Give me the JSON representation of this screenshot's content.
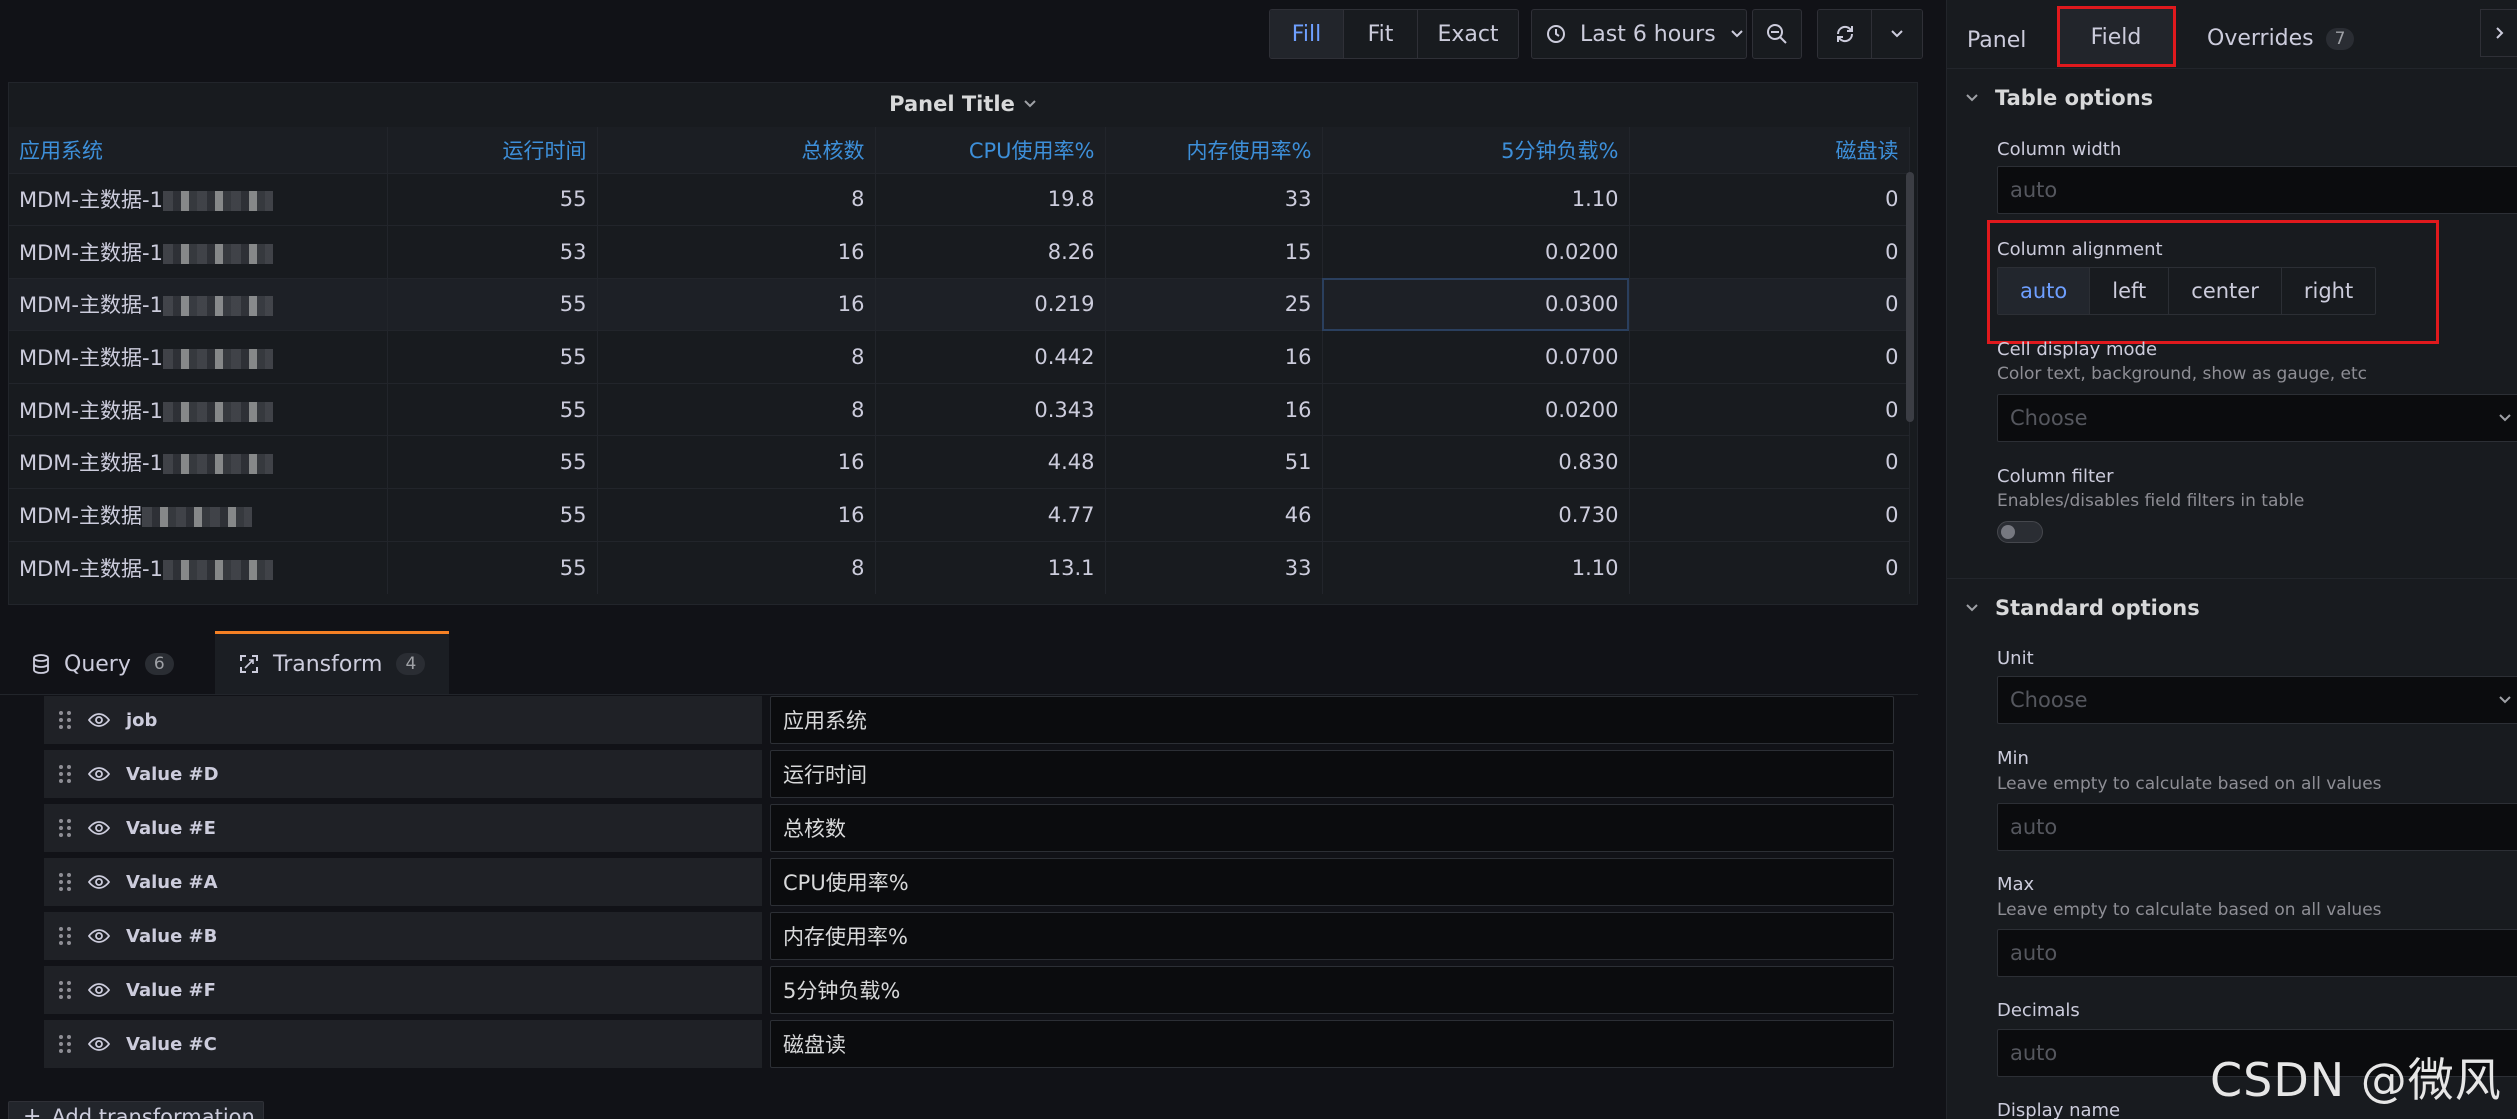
{
  "toolbar": {
    "fill": "Fill",
    "fit": "Fit",
    "exact": "Exact",
    "time_range": "Last 6 hours"
  },
  "panel": {
    "title": "Panel Title",
    "columns": [
      "应用系统",
      "运行时间",
      "总核数",
      "CPU使用率%",
      "内存使用率%",
      "5分钟负载%",
      "磁盘读"
    ],
    "rows": [
      [
        "MDM-主数据-1",
        "55",
        "8",
        "19.8",
        "33",
        "1.10",
        "0"
      ],
      [
        "MDM-主数据-1",
        "53",
        "16",
        "8.26",
        "15",
        "0.0200",
        "0"
      ],
      [
        "MDM-主数据-1",
        "55",
        "16",
        "0.219",
        "25",
        "0.0300",
        "0"
      ],
      [
        "MDM-主数据-1",
        "55",
        "8",
        "0.442",
        "16",
        "0.0700",
        "0"
      ],
      [
        "MDM-主数据-1",
        "55",
        "8",
        "0.343",
        "16",
        "0.0200",
        "0"
      ],
      [
        "MDM-主数据-1",
        "55",
        "16",
        "4.48",
        "51",
        "0.830",
        "0"
      ],
      [
        "MDM-主数据",
        "55",
        "16",
        "4.77",
        "46",
        "0.730",
        "0"
      ],
      [
        "MDM-主数据-1",
        "55",
        "8",
        "13.1",
        "33",
        "1.10",
        "0"
      ]
    ]
  },
  "tabs": {
    "query": {
      "label": "Query",
      "count": "6"
    },
    "transform": {
      "label": "Transform",
      "count": "4"
    }
  },
  "transforms": [
    {
      "field": "job",
      "rename": "应用系统"
    },
    {
      "field": "Value #D",
      "rename": "运行时间"
    },
    {
      "field": "Value #E",
      "rename": "总核数"
    },
    {
      "field": "Value #A",
      "rename": "CPU使用率%"
    },
    {
      "field": "Value #B",
      "rename": "内存使用率%"
    },
    {
      "field": "Value #F",
      "rename": "5分钟负载%"
    },
    {
      "field": "Value #C",
      "rename": "磁盘读"
    }
  ],
  "add_transformation": "Add transformation",
  "options": {
    "tabs": {
      "panel": "Panel",
      "field": "Field",
      "overrides": "Overrides",
      "overrides_count": "7"
    },
    "table_options": {
      "title": "Table options",
      "column_width": {
        "label": "Column width",
        "placeholder": "auto"
      },
      "column_alignment": {
        "label": "Column alignment",
        "choices": [
          "auto",
          "left",
          "center",
          "right"
        ],
        "selected": "auto"
      },
      "cell_display_mode": {
        "label": "Cell display mode",
        "description": "Color text, background, show as gauge, etc",
        "placeholder": "Choose"
      },
      "column_filter": {
        "label": "Column filter",
        "description": "Enables/disables field filters in table"
      }
    },
    "standard_options": {
      "title": "Standard options",
      "unit": {
        "label": "Unit",
        "placeholder": "Choose"
      },
      "min": {
        "label": "Min",
        "description": "Leave empty to calculate based on all values",
        "placeholder": "auto"
      },
      "max": {
        "label": "Max",
        "description": "Leave empty to calculate based on all values",
        "placeholder": "auto"
      },
      "decimals": {
        "label": "Decimals",
        "placeholder": "auto"
      },
      "display_name": {
        "label": "Display name"
      }
    }
  },
  "watermark": "CSDN @微风",
  "colors": {
    "accent": "#6e9fff",
    "highlight": "#e0191d",
    "tab_active": "#f58024",
    "header_text": "#3d8fd9"
  }
}
